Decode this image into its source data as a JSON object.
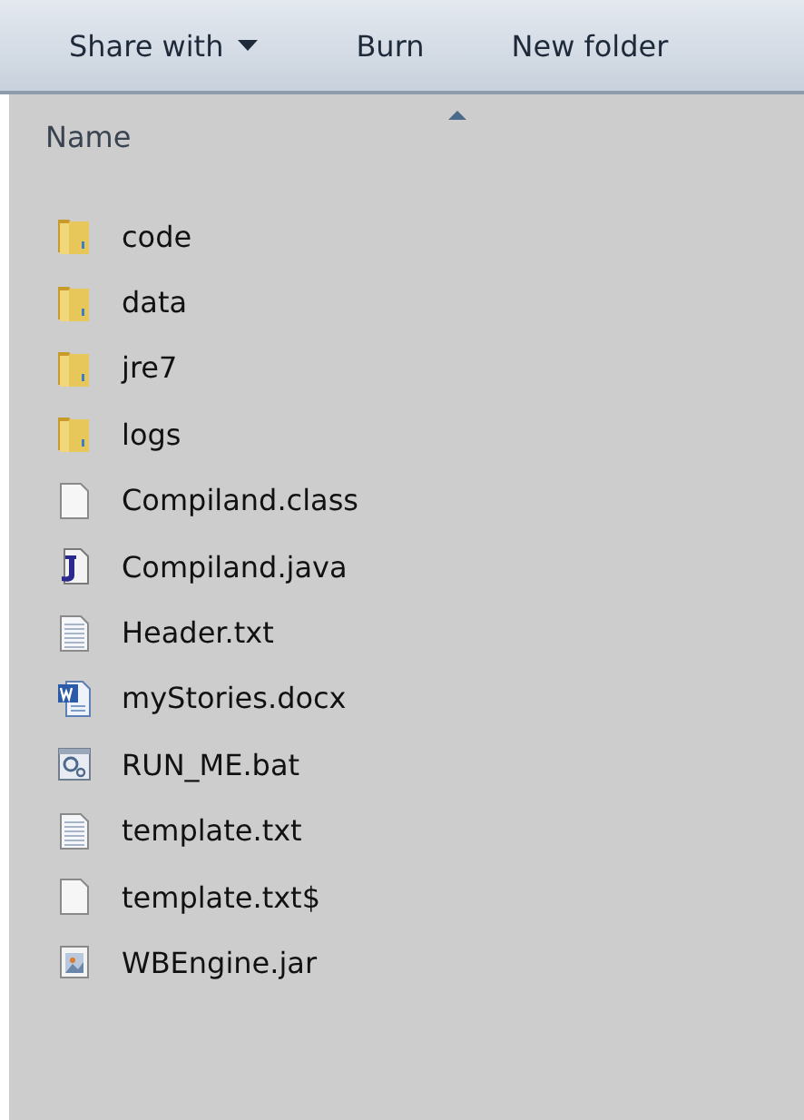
{
  "toolbar": [
    {
      "label": "Share with",
      "dropdown": true
    },
    {
      "label": "Burn",
      "dropdown": false
    },
    {
      "label": "New folder",
      "dropdown": false
    }
  ],
  "column_header": {
    "label": "Name",
    "sorted_ascending": true
  },
  "files": [
    {
      "name": "code",
      "kind": "folder"
    },
    {
      "name": "data",
      "kind": "folder"
    },
    {
      "name": "jre7",
      "kind": "folder"
    },
    {
      "name": "logs",
      "kind": "folder"
    },
    {
      "name": "Compiland.class",
      "kind": "blank"
    },
    {
      "name": "Compiland.java",
      "kind": "java"
    },
    {
      "name": "Header.txt",
      "kind": "text"
    },
    {
      "name": "myStories.docx",
      "kind": "word"
    },
    {
      "name": "RUN_ME.bat",
      "kind": "batch"
    },
    {
      "name": "template.txt",
      "kind": "text"
    },
    {
      "name": "template.txt$",
      "kind": "blank"
    },
    {
      "name": "WBEngine.jar",
      "kind": "jar"
    }
  ]
}
